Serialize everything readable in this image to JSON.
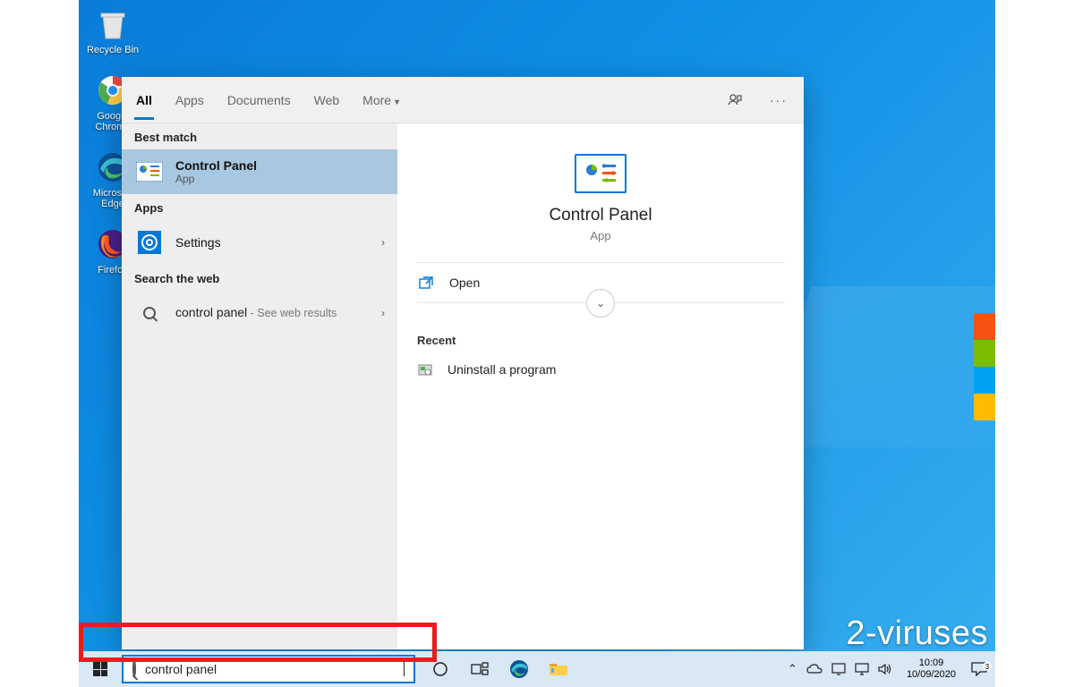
{
  "desktop": {
    "icons": [
      {
        "label": "Recycle Bin"
      },
      {
        "label": "Google Chrome"
      },
      {
        "label": "Microsoft Edge"
      },
      {
        "label": "Firefox"
      }
    ]
  },
  "search": {
    "tabs": [
      "All",
      "Apps",
      "Documents",
      "Web",
      "More"
    ],
    "active_tab": 0,
    "sections": {
      "best_match_header": "Best match",
      "apps_header": "Apps",
      "web_header": "Search the web"
    },
    "best_match": {
      "title": "Control Panel",
      "subtitle": "App"
    },
    "apps_result": {
      "title": "Settings"
    },
    "web_result": {
      "query": "control panel",
      "suffix": " - See web results"
    },
    "details": {
      "title": "Control Panel",
      "subtitle": "App",
      "open_label": "Open",
      "recent_header": "Recent",
      "recent_items": [
        "Uninstall a program"
      ]
    },
    "input_value": "control panel"
  },
  "taskbar": {
    "time": "10:09",
    "date": "10/09/2020",
    "notification_count": "3"
  },
  "watermark": "2-viruses"
}
